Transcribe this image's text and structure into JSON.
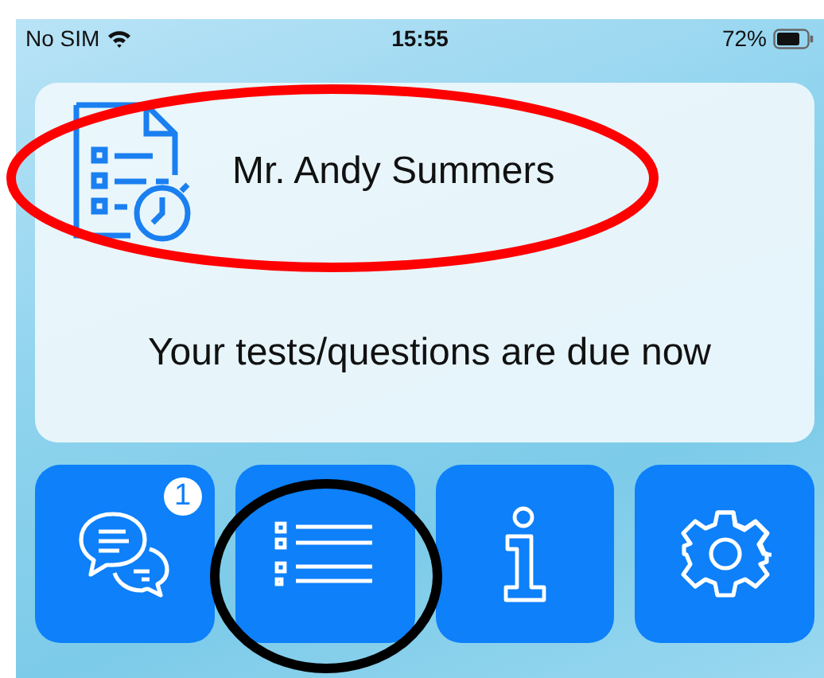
{
  "status_bar": {
    "carrier": "No SIM",
    "time": "15:55",
    "battery": "72%"
  },
  "card": {
    "name": "Mr. Andy Summers",
    "message": "Your tests/questions are due now"
  },
  "buttons": [
    {
      "kind": "chat",
      "badge": "1"
    },
    {
      "kind": "list"
    },
    {
      "kind": "info"
    },
    {
      "kind": "settings"
    }
  ],
  "annotations": [
    {
      "kind": "ellipse",
      "color": "#ff0000"
    },
    {
      "kind": "circle",
      "color": "#000000"
    }
  ]
}
